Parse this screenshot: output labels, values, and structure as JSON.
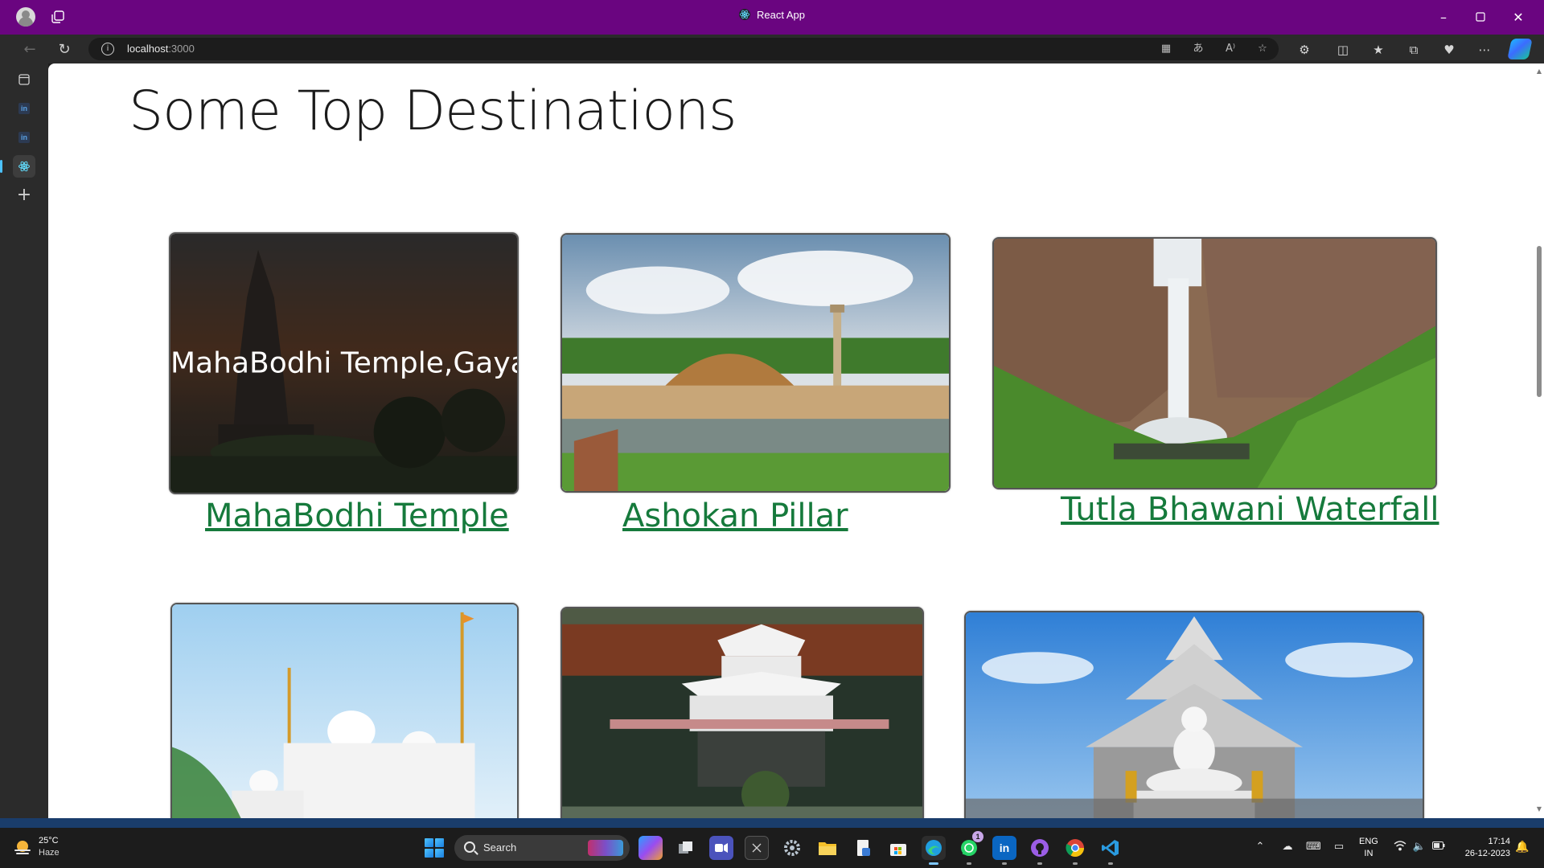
{
  "browser": {
    "tab_title": "React App",
    "url_host": "localhost",
    "url_port": ":3000"
  },
  "page": {
    "title": "Some Top Destinations",
    "cards": [
      {
        "overlay": "MahaBodhi Temple,Gaya",
        "link": "MahaBodhi Temple"
      },
      {
        "link": "Ashokan Pillar"
      },
      {
        "link": "Tutla Bhawani Waterfall"
      }
    ]
  },
  "sidebar": {
    "items": [
      {
        "icon": "tabs-icon"
      },
      {
        "icon": "linkedin-icon",
        "label": "in"
      },
      {
        "icon": "linkedin-icon",
        "label": "in"
      },
      {
        "icon": "react-icon"
      },
      {
        "icon": "plus-icon"
      }
    ]
  },
  "taskbar": {
    "weather": {
      "temp": "25°C",
      "condition": "Haze"
    },
    "search_label": "Search",
    "linkedin_label": "in",
    "lang_top": "ENG",
    "lang_bottom": "IN",
    "time": "17:14",
    "date": "26-12-2023",
    "whatsapp_badge": "1"
  },
  "colors": {
    "titlebar": "#6a0580",
    "link": "#167a3c",
    "taskbar": "#1c1c1c"
  }
}
